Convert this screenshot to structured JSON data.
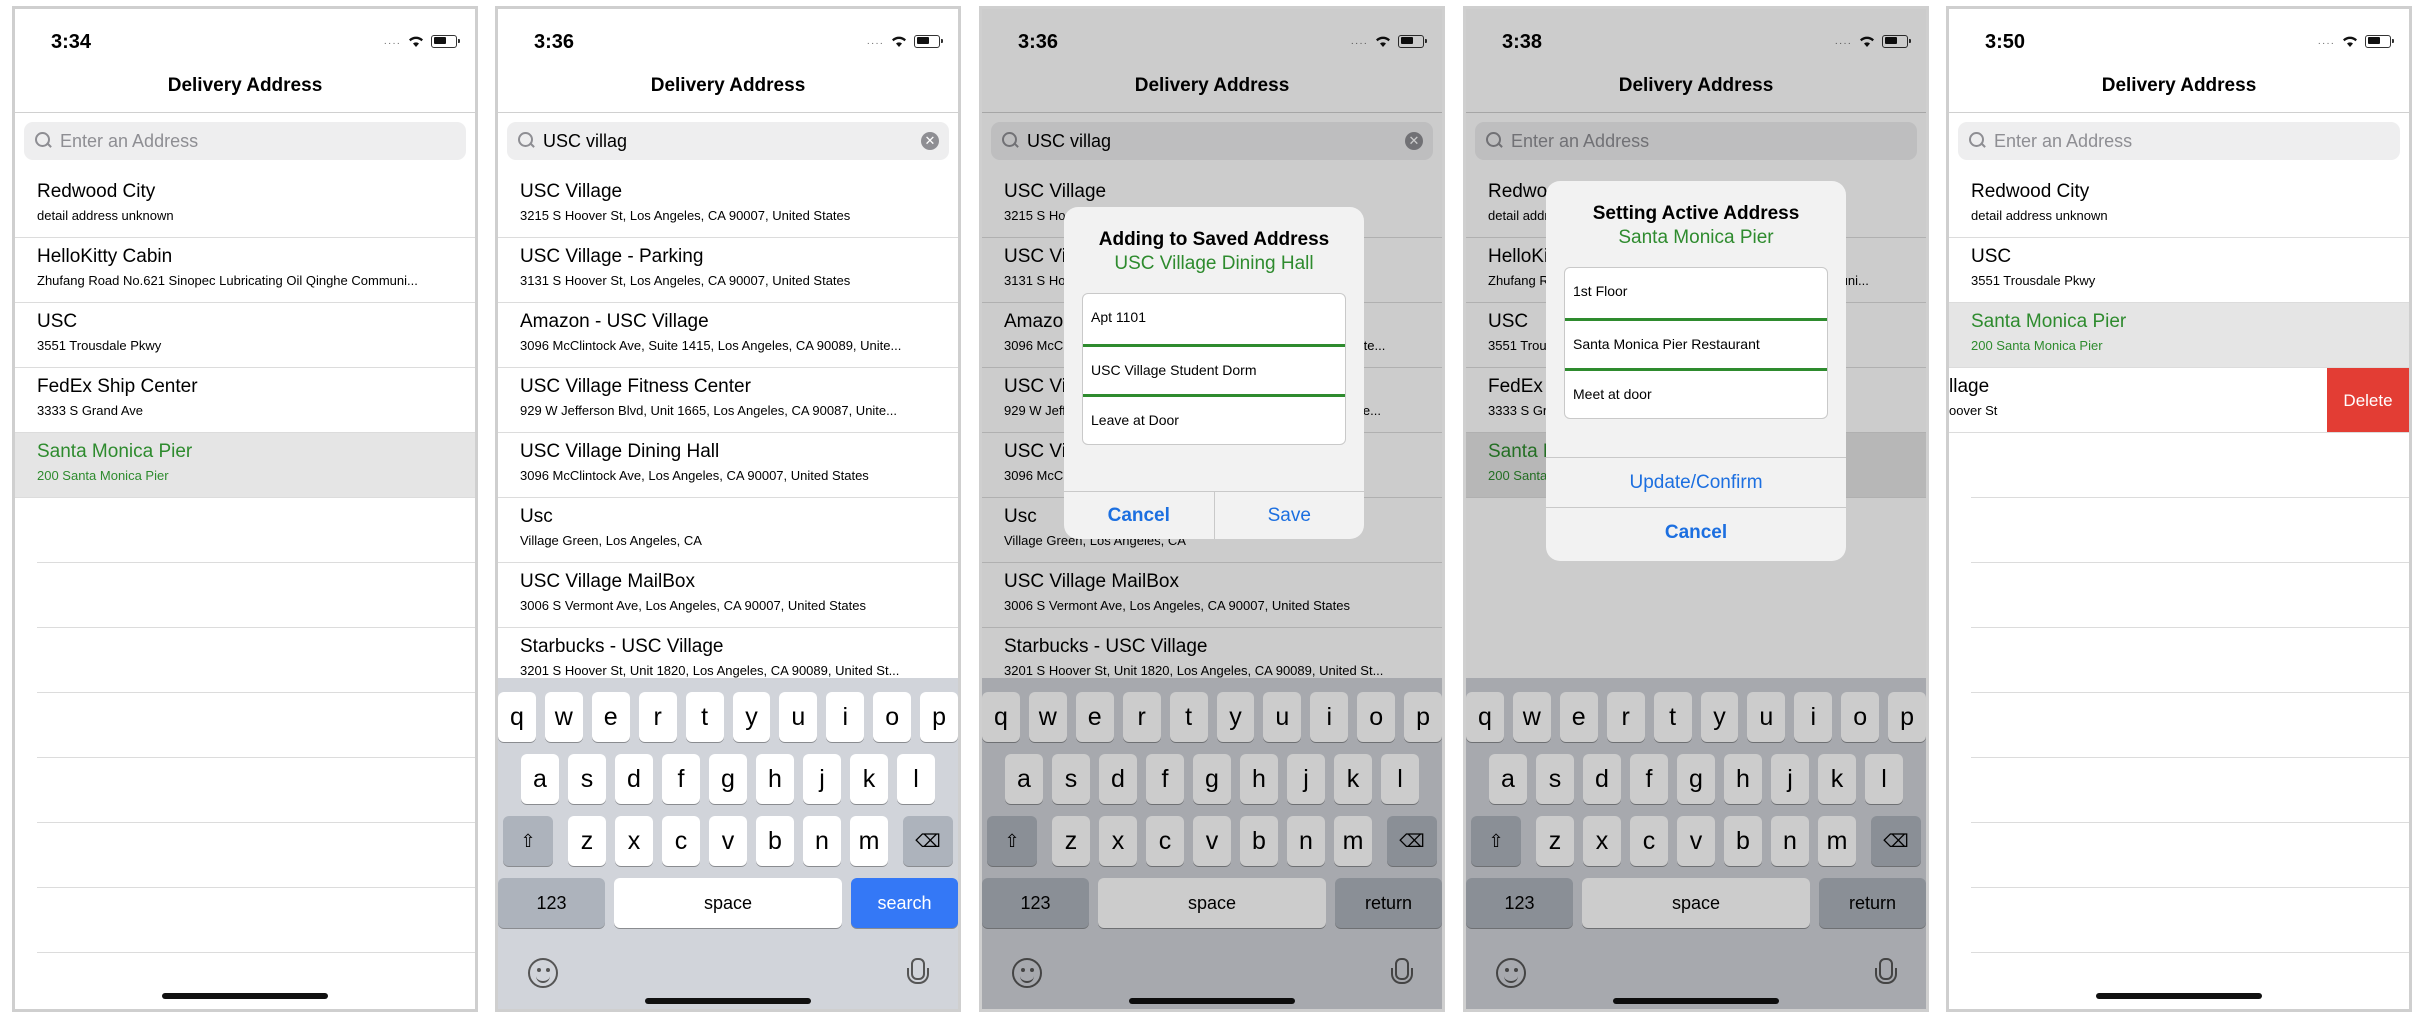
{
  "screens": [
    {
      "time": "3:34",
      "title": "Delivery Address",
      "search": {
        "placeholder": "Enter an Address",
        "value": ""
      },
      "rows": [
        {
          "title": "Redwood City",
          "subtitle": "detail address unknown"
        },
        {
          "title": "HelloKitty Cabin",
          "subtitle": "Zhufang Road No.621 Sinopec Lubricating Oil Qinghe Communi..."
        },
        {
          "title": "USC",
          "subtitle": "3551 Trousdale Pkwy"
        },
        {
          "title": "FedEx Ship Center",
          "subtitle": "3333 S Grand Ave"
        },
        {
          "title": "Santa Monica Pier",
          "subtitle": "200 Santa Monica Pier",
          "selected": true
        }
      ]
    },
    {
      "time": "3:36",
      "title": "Delivery Address",
      "search": {
        "placeholder": "",
        "value": "USC villag"
      },
      "rows": [
        {
          "title": "USC Village",
          "subtitle": "3215 S Hoover St, Los Angeles, CA  90007, United States"
        },
        {
          "title": "USC Village - Parking",
          "subtitle": "3131 S Hoover St, Los Angeles, CA  90007, United States"
        },
        {
          "title": "Amazon - USC Village",
          "subtitle": "3096 McClintock Ave, Suite 1415, Los Angeles, CA 90089, Unite..."
        },
        {
          "title": "USC Village Fitness Center",
          "subtitle": "929 W Jefferson Blvd, Unit 1665, Los Angeles, CA 90087, Unite..."
        },
        {
          "title": "USC Village Dining Hall",
          "subtitle": "3096 McClintock Ave, Los Angeles, CA  90007, United States"
        },
        {
          "title": "Usc",
          "subtitle": "Village Green, Los Angeles, CA"
        },
        {
          "title": "USC Village MailBox",
          "subtitle": "3006 S Vermont Ave, Los Angeles, CA  90007, United States"
        },
        {
          "title": "Starbucks - USC Village",
          "subtitle": "3201 S Hoover St, Unit 1820, Los Angeles, CA 90089, United St..."
        }
      ],
      "return_key": "search"
    },
    {
      "time": "3:36",
      "title": "Delivery Address",
      "search": {
        "placeholder": "",
        "value": "USC villag"
      },
      "rows": [
        {
          "title": "USC Village",
          "subtitle": "3215 S Hoover St, Los Angeles, CA  90007, United States"
        },
        {
          "title": "USC Village - Parking",
          "subtitle": "3131 S Hoover St, Los Angeles, CA  90007, United States"
        },
        {
          "title": "Amazon - USC Village",
          "subtitle": "3096 McClintock Ave, Suite 1415, Los Angeles, CA 90089, Unite..."
        },
        {
          "title": "USC Village Fitness Center",
          "subtitle": "929 W Jefferson Blvd, Unit 1665, Los Angeles, CA 90087, Unite..."
        },
        {
          "title": "USC Village Dining Hall",
          "subtitle": "3096 McClintock Ave, Los Angeles, CA  90007, United States"
        },
        {
          "title": "Usc",
          "subtitle": "Village Green, Los Angeles, CA"
        },
        {
          "title": "USC Village MailBox",
          "subtitle": "3006 S Vermont Ave, Los Angeles, CA  90007, United States"
        },
        {
          "title": "Starbucks - USC Village",
          "subtitle": "3201 S Hoover St, Unit 1820, Los Angeles, CA 90089, United St..."
        }
      ],
      "return_key": "return",
      "dialog": {
        "title": "Adding to Saved Address",
        "subtitle": "USC Village Dining Hall",
        "fields": [
          "Apt 1101",
          "USC Village Student Dorm",
          "Leave at Door"
        ],
        "cancel": "Cancel",
        "confirm": "Save"
      }
    },
    {
      "time": "3:38",
      "title": "Delivery Address",
      "search": {
        "placeholder": "Enter an Address",
        "value": ""
      },
      "rows": [
        {
          "title": "Redwood City",
          "subtitle": "detail address unknown"
        },
        {
          "title": "HelloKitty Cabin",
          "subtitle": "Zhufang Road No.621 Sinopec Lubricating Oil Qinghe Communi..."
        },
        {
          "title": "USC",
          "subtitle": "3551 Trousdale Pkwy"
        },
        {
          "title": "FedEx Ship Center",
          "subtitle": "3333 S Grand Ave"
        },
        {
          "title": "Santa Monica Pier",
          "subtitle": "200 Santa Monica Pier",
          "selected": true
        }
      ],
      "return_key": "return",
      "dialog": {
        "title": "Setting Active Address",
        "subtitle": "Santa Monica Pier",
        "fields": [
          "1st Floor",
          "Santa Monica Pier Restaurant",
          "Meet at door"
        ],
        "confirm": "Update/Confirm",
        "cancel": "Cancel"
      }
    },
    {
      "time": "3:50",
      "title": "Delivery Address",
      "search": {
        "placeholder": "Enter an Address",
        "value": ""
      },
      "rows": [
        {
          "title": "Redwood City",
          "subtitle": "detail address unknown"
        },
        {
          "title": "USC",
          "subtitle": "3551 Trousdale Pkwy"
        },
        {
          "title": "Santa Monica Pier",
          "subtitle": "200 Santa Monica Pier",
          "selected": true
        },
        {
          "title": "llage",
          "subtitle": "oover St"
        }
      ],
      "delete_label": "Delete"
    }
  ],
  "keyboard": {
    "row1": [
      "q",
      "w",
      "e",
      "r",
      "t",
      "y",
      "u",
      "i",
      "o",
      "p"
    ],
    "row2": [
      "a",
      "s",
      "d",
      "f",
      "g",
      "h",
      "j",
      "k",
      "l"
    ],
    "row3": [
      "z",
      "x",
      "c",
      "v",
      "b",
      "n",
      "m"
    ],
    "numbers": "123",
    "space": "space"
  },
  "colors": {
    "accent_green": "#2e8b2e",
    "link_blue": "#1c6fe0",
    "delete_red": "#e33d34",
    "search_key_blue": "#3478f6"
  }
}
